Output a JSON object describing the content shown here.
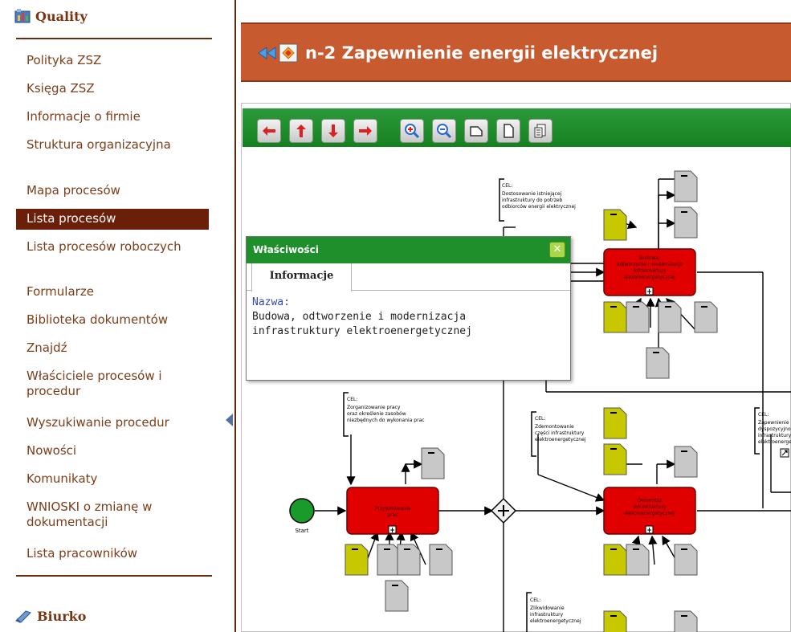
{
  "sidebar": {
    "section_title": "Quality",
    "section_icon": "quality-app-icon",
    "items": [
      {
        "label": "Polityka ZSZ",
        "active": false
      },
      {
        "label": "Księga ZSZ",
        "active": false
      },
      {
        "label": "Informacje o firmie",
        "active": false
      },
      {
        "label": "Struktura organizacyjna",
        "active": false
      },
      {
        "label": "Mapa procesów",
        "active": false
      },
      {
        "label": "Lista procesów",
        "active": true
      },
      {
        "label": "Lista procesów roboczych",
        "active": false
      },
      {
        "label": "Formularze",
        "active": false
      },
      {
        "label": "Biblioteka dokumentów",
        "active": false
      },
      {
        "label": "Znajdź",
        "active": false
      },
      {
        "label": "Właściciele procesów i procedur",
        "active": false
      },
      {
        "label": "Wyszukiwanie procedur",
        "active": false
      },
      {
        "label": "Nowości",
        "active": false
      },
      {
        "label": "Komunikaty",
        "active": false
      },
      {
        "label": "WNIOSKI o zmianę w dokumentacji",
        "active": false
      },
      {
        "label": "Lista pracowników",
        "active": false
      }
    ],
    "bottom_title": "Biurko",
    "bottom_icon": "desk-icon"
  },
  "header": {
    "title": "n-2 Zapewnienie energii elektrycznej",
    "back_icon": "double-left-arrow-icon",
    "process_icon": "process-map-icon"
  },
  "toolbar": {
    "buttons": [
      "pan-left",
      "pan-up",
      "pan-down",
      "pan-right",
      "zoom-in",
      "zoom-out",
      "fit-width",
      "fit-page",
      "print"
    ]
  },
  "properties": {
    "title": "Właściwości",
    "close_icon": "close-icon",
    "tab": "Informacje",
    "name_label": "Nazwa:",
    "name_value_line1": "Budowa,  odtworzenie i modernizacja",
    "name_value_line2": "infrastruktury  elektroenergetycznej"
  },
  "diagram": {
    "start_label": "Start",
    "cel_label": "CEL:",
    "cel_notes": [
      "Dostosowanie istniejącej infrastruktury do potrzeb odbiorców energii elektrycznej",
      "Zorganizowanie pracy oraz określenie zasobów niezbędnych do wykonania prac",
      "Zdemontowanie części infrastruktury elektroenergetycznej",
      "Zlikwidowanie infrastruktury elektroenergetycznej",
      "Zapewnienie dyspozycyjności infrastruktury elektroenergetycznej"
    ],
    "tasks": [
      "Budowa, odtworzenie i modernizacja infrastruktury elektroenergetycznej",
      "Przygotowanie prac",
      "Demontaż infrastruktury elektroenergetycznej"
    ],
    "colors": {
      "task_fill": "#e00000",
      "doc_gray": "#c8c8c8",
      "doc_olive": "#c8c800",
      "start_fill": "#1a9a2a",
      "toolbar_green": "#16801f",
      "header_orange": "#c85a30",
      "active_nav": "#6b1e08"
    }
  }
}
